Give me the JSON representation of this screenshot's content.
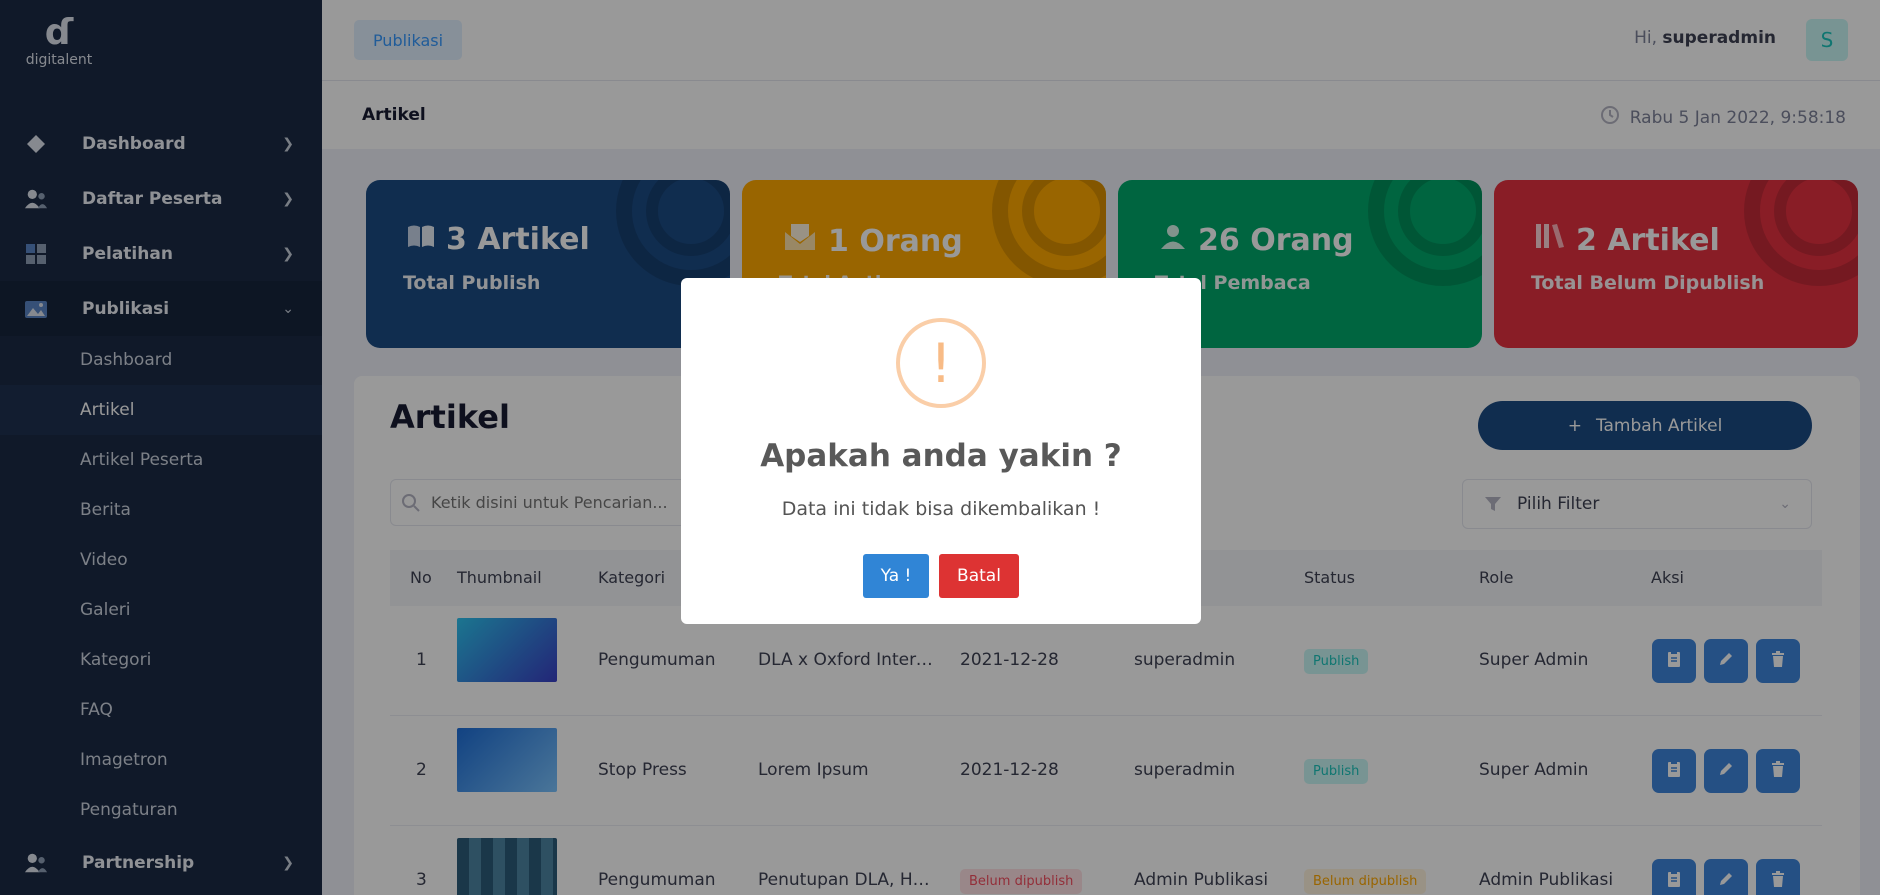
{
  "sidebar": {
    "logo_text": "digitalent",
    "nav": [
      {
        "label": "Dashboard",
        "icon": "diamond-icon"
      },
      {
        "label": "Daftar Peserta",
        "icon": "users-icon"
      },
      {
        "label": "Pelatihan",
        "icon": "grid-icon"
      },
      {
        "label": "Publikasi",
        "icon": "image-icon"
      }
    ],
    "sub": [
      "Dashboard",
      "Artikel",
      "Artikel Peserta",
      "Berita",
      "Video",
      "Galeri",
      "Kategori",
      "FAQ",
      "Imagetron",
      "Pengaturan"
    ],
    "partnership": "Partnership"
  },
  "header": {
    "button": "Publikasi",
    "greeting": "Hi,",
    "user": "superadmin",
    "avatar": "S",
    "subheader_title": "Artikel",
    "datetime": "Rabu 5 Jan 2022, 9:58:18"
  },
  "cards": [
    {
      "big": "3 Artikel",
      "small": "Total Publish",
      "color": "#1b4b84"
    },
    {
      "big": "1 Orang",
      "small": "Total Author",
      "color": "#ffa800"
    },
    {
      "big": "26 Orang",
      "small": "Total Pembaca",
      "color": "#00a86b"
    },
    {
      "big": "2 Artikel",
      "small": "Total Belum Dipublish",
      "color": "#e53140"
    }
  ],
  "main": {
    "title": "Artikel",
    "add_button": "Tambah Artikel",
    "search_placeholder": "Ketik disini untuk Pencarian...",
    "filter": "Pilih Filter",
    "columns": [
      "No",
      "Thumbnail",
      "Kategori",
      "",
      "",
      "",
      "Status",
      "Role",
      "Aksi"
    ],
    "rows": [
      {
        "no": "1",
        "kategori": "Pengumuman",
        "judul": "DLA x Oxford Internet Institute",
        "tanggal": "2021-12-28",
        "author": "superadmin",
        "status": "Publish",
        "role": "Super Admin"
      },
      {
        "no": "2",
        "kategori": "Stop Press",
        "judul": "Lorem Ipsum",
        "tanggal": "2021-12-28",
        "author": "superadmin",
        "status": "Publish",
        "role": "Super Admin"
      },
      {
        "no": "3",
        "kategori": "Pengumuman",
        "judul": "Penutupan DLA, Haryanto",
        "tanggal": "Belum dipublish",
        "author": "Admin Publikasi",
        "status": "Belum dipublish",
        "role": "Admin Publikasi"
      }
    ]
  },
  "modal": {
    "icon": "!",
    "title": "Apakah anda yakin ?",
    "text": "Data ini tidak bisa dikembalikan !",
    "confirm": "Ya !",
    "cancel": "Batal"
  }
}
